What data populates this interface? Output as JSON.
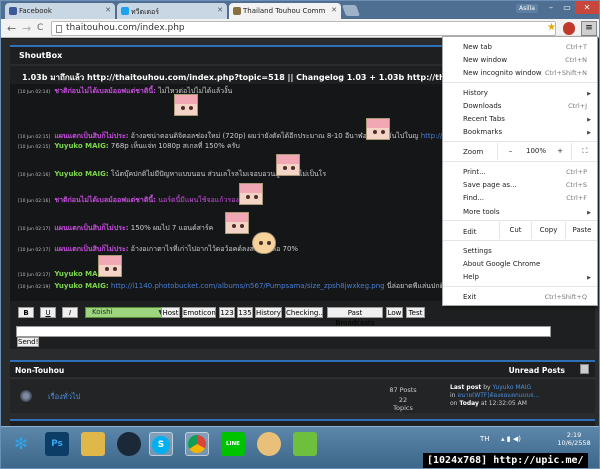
{
  "tabs": [
    {
      "label": "Facebook",
      "favicon_color": "#3b5998"
    },
    {
      "label": "ทวีตเตอร์",
      "favicon_color": "#1da1f2"
    },
    {
      "label": "Thailand Touhou Comm",
      "favicon_color": "#8a6f3f"
    }
  ],
  "window": {
    "user_label": "Asilla",
    "minimize": "–",
    "maximize": "▭",
    "close": "✕"
  },
  "toolbar": {
    "back": "←",
    "forward": "→",
    "reload": "C",
    "url": "thaitouhou.com/index.php",
    "star": "★",
    "menu_icon": "≡"
  },
  "shoutbox": {
    "title": "ShoutBox",
    "ticker": "1.03b มาถึกแล้ว http://thaitouhou.com/index.php?topic=518 || Changelog 1.03 + 1.03b http://thaitouhou.com/index.php",
    "messages": [
      {
        "ts": "[10 Jun 02:14]",
        "user": "ชาติก่อนไม่ได้เบลม์ออฟแต่ชาตินี้:",
        "user_color": "#c74de0",
        "text": "ไม่ไหวต่อไปไม่ได้แล้วงั้น",
        "link": ""
      },
      {
        "ts": "[10 Jun 02:15]",
        "user": "แผนแตกเป็นสิบก็ไม่ประ:",
        "user_color": "#c74de0",
        "text": "อ้างอซน่าตอนดิจิตอลช่องใหม่ (720p) ผมว่ายังตัดได้อีกประมาณ 8-10 อีนาฬออีไม่ถ้าอันไปในญ",
        "link": "http://i.imgur.c"
      },
      {
        "ts": "[10 Jun 02:15]",
        "user": "Yuyuko MAIG:",
        "user_color": "#7cd64b",
        "text": "768p เห็นแจ่ท 1080p สเกลที่ 150% ครับ",
        "link": ""
      },
      {
        "ts": "[10 Jun 02:16]",
        "user": "Yuyuko MAIG:",
        "user_color": "#7cd64b",
        "text": "โน้ตบุ๊คปกติไม่มีปัญหาแบบนอน ส่วนเลโรลไมเจอบอวนภูมลเว้าไม่เป็นโร",
        "link": ""
      },
      {
        "ts": "[10 Jun 02:16]",
        "user": "ชาติก่อนไม่ได้เบลม์ออฟแต่ชาตินี้:",
        "user_color": "#c74de0",
        "text": "นอร์ตนี้มีแผนใช้จอแก้วรอง",
        "link": ""
      },
      {
        "ts": "[10 Jun 02:17]",
        "user": "แผนแตกเป็นสิบก็ไม่ประ:",
        "user_color": "#c74de0",
        "text": "150% ผมไป 7 แอนด์สาร์ค",
        "link": ""
      },
      {
        "ts": "[10 Jun 02:17]",
        "user": "แผนแตกเป็นสิบก็ไม่ประ:",
        "user_color": "#c74de0",
        "text": "อ้างอเกาตาไรที่เก่าไปอากไว้ดอว้อคด์ลงสเกลเหลือ 70%",
        "link": ""
      },
      {
        "ts": "[10 Jun 02:17]",
        "user": "Yuyuko MAIG:",
        "user_color": "#7cd64b",
        "text": "",
        "link": ""
      },
      {
        "ts": "[10 Jun 02:19]",
        "user": "Yuyuko MAIG:",
        "user_color": "#7cd64b",
        "text": "นี่ล่อยาดพีแล่นปกติ",
        "link": "http://i1140.photobucket.com/albums/n567/Pumpsama/size_zpsh8jwxkeg.png"
      }
    ]
  },
  "controls": {
    "bold": "B",
    "underline": "U",
    "italic": "I",
    "font": "Koishi",
    "buttons": [
      "Host",
      "Emoticon",
      "123",
      "135",
      "History",
      "Checking...",
      "Past Broadcasts",
      "Low",
      "Test"
    ],
    "send": "Send!"
  },
  "category": {
    "title": "Non-Touhou",
    "unread": "Unread Posts"
  },
  "board": {
    "name": "เรื่องทั่วไป",
    "posts": "87 Posts",
    "topics": "22 Topics",
    "last_post_label": "Last post",
    "last_post_by": "by",
    "last_post_user": "Yuyuko MAIG",
    "last_post_in": "in",
    "last_post_topic": "อนาย(WTF)ต้องจอแตกแบบจ...",
    "last_post_on": "on",
    "last_post_day": "Today",
    "last_post_time": "at 12:32:05 AM"
  },
  "chrome_menu": {
    "new_tab": {
      "label": "New tab",
      "key": "Ctrl+T"
    },
    "new_window": {
      "label": "New window",
      "key": "Ctrl+N"
    },
    "new_incognito": {
      "label": "New incognito window",
      "key": "Ctrl+Shift+N"
    },
    "history": {
      "label": "History"
    },
    "downloads": {
      "label": "Downloads",
      "key": "Ctrl+J"
    },
    "recent_tabs": {
      "label": "Recent Tabs"
    },
    "bookmarks": {
      "label": "Bookmarks"
    },
    "zoom": {
      "label": "Zoom",
      "minus": "–",
      "value": "100%",
      "plus": "+",
      "fullscreen": "⛶"
    },
    "print": {
      "label": "Print...",
      "key": "Ctrl+P"
    },
    "save_as": {
      "label": "Save page as...",
      "key": "Ctrl+S"
    },
    "find": {
      "label": "Find...",
      "key": "Ctrl+F"
    },
    "more_tools": {
      "label": "More tools"
    },
    "edit": {
      "label": "Edit",
      "cut": "Cut",
      "copy": "Copy",
      "paste": "Paste"
    },
    "settings": {
      "label": "Settings"
    },
    "about": {
      "label": "About Google Chrome"
    },
    "help": {
      "label": "Help"
    },
    "exit": {
      "label": "Exit",
      "key": "Ctrl+Shift+Q"
    }
  },
  "taskbar": {
    "apps": [
      {
        "name": "ps",
        "label": "Ps",
        "color": "#0c3d66"
      },
      {
        "name": "explorer",
        "label": "",
        "color": "#e0b84a"
      },
      {
        "name": "steam",
        "label": "",
        "color": "#1b2838"
      },
      {
        "name": "skype",
        "label": "S",
        "color": "#00aff0"
      },
      {
        "name": "chrome",
        "label": "",
        "color": "#db4437"
      },
      {
        "name": "line",
        "label": "LINE",
        "color": "#00c300"
      },
      {
        "name": "avatar-app",
        "label": "",
        "color": "#e8c07a"
      },
      {
        "name": "bluestacks",
        "label": "",
        "color": "#6fbf3f"
      }
    ],
    "lang": "TH",
    "time": "2:19",
    "date": "10/6/2558"
  },
  "watermark": "[1024x768]  http://upic.me/"
}
